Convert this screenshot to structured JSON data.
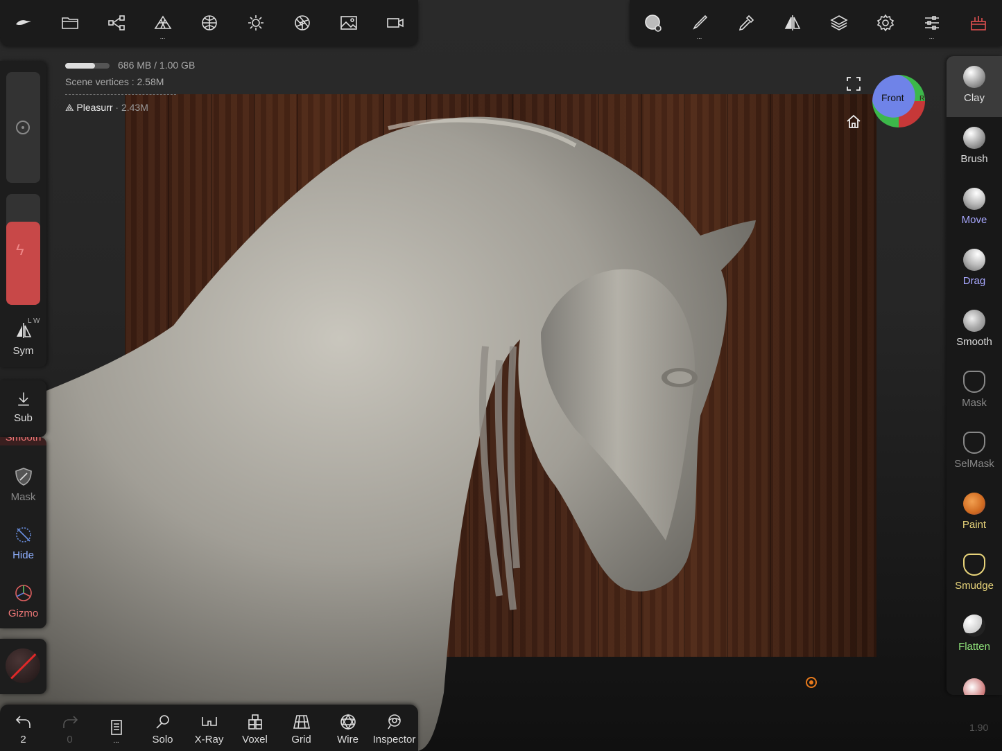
{
  "top_toolbar_left": [
    {
      "icon": "nomad-logo-icon"
    },
    {
      "icon": "folder-icon"
    },
    {
      "icon": "scene-graph-icon"
    },
    {
      "icon": "topology-icon",
      "dots": "..."
    },
    {
      "icon": "material-sphere-icon"
    },
    {
      "icon": "light-sun-icon"
    },
    {
      "icon": "camera-shutter-icon"
    },
    {
      "icon": "image-icon"
    },
    {
      "icon": "video-camera-icon"
    }
  ],
  "top_toolbar_right": [
    {
      "icon": "tool-preview-icon"
    },
    {
      "icon": "brush-stroke-icon",
      "dots": "..."
    },
    {
      "icon": "eyedropper-icon"
    },
    {
      "icon": "symmetry-icon"
    },
    {
      "icon": "layers-icon"
    },
    {
      "icon": "settings-gear-icon"
    },
    {
      "icon": "sliders-icon",
      "dots": "..."
    },
    {
      "icon": "toolbox-icon"
    }
  ],
  "info": {
    "memory": "686 MB / 1.00 GB",
    "memory_fraction": 0.67,
    "scene_vertices_label": "Scene vertices :",
    "scene_vertices": "2.58M",
    "object_name": "Pleasurr",
    "object_vertices": "· 2.43M"
  },
  "left_panel": {
    "sym": {
      "label": "Sym",
      "hint": "L W"
    },
    "sub": {
      "label": "Sub"
    },
    "smooth_partial": "Smooth",
    "mask": {
      "label": "Mask"
    },
    "hide": {
      "label": "Hide"
    },
    "gizmo": {
      "label": "Gizmo"
    }
  },
  "right_panel": {
    "tools": [
      {
        "label": "Clay",
        "color": "#dddddd",
        "active": true
      },
      {
        "label": "Brush",
        "color": "#dddddd"
      },
      {
        "label": "Move",
        "color": "#a8a8ff"
      },
      {
        "label": "Drag",
        "color": "#a8a8ff"
      },
      {
        "label": "Smooth",
        "color": "#dddddd"
      },
      {
        "label": "Mask",
        "color": "#888888"
      },
      {
        "label": "SelMask",
        "color": "#888888"
      },
      {
        "label": "Paint",
        "color": "#e8d47a"
      },
      {
        "label": "Smudge",
        "color": "#e8d47a"
      },
      {
        "label": "Flatten",
        "color": "#8fe27a"
      }
    ]
  },
  "viewport": {
    "orientation_label": "Front",
    "orientation_side": "R"
  },
  "bottom_bar": {
    "undo_count": "2",
    "redo_count": "0",
    "items": [
      "Solo",
      "X-Ray",
      "Voxel",
      "Grid",
      "Wire",
      "Inspector"
    ],
    "file_dots": "..."
  },
  "version": "1.90"
}
